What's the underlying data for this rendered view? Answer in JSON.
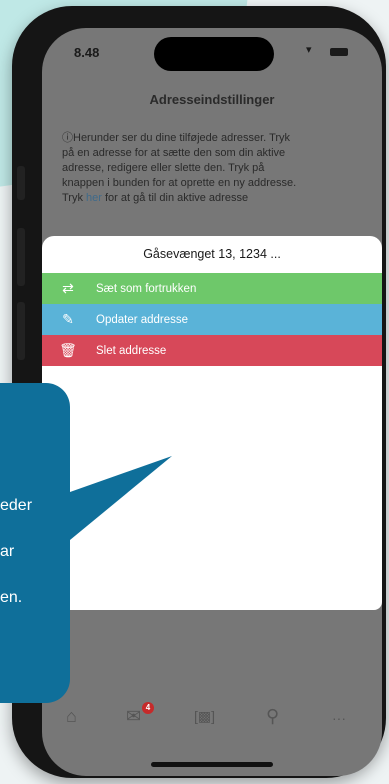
{
  "status": {
    "time": "8.48"
  },
  "nav": {
    "title": "Adresseindstillinger"
  },
  "info": {
    "line1": "ⓘHerunder ser du dine tilføjede adresser. Tryk",
    "line2": "på en adresse for at sætte den som din aktive",
    "line3": "adresse, redigere eller slette den. Tryk på",
    "line4": "knappen i bunden for at oprette en ny addresse.",
    "line5_pre": "Tryk ",
    "line5_link": "her",
    "line5_post": " for at gå til din aktive adresse"
  },
  "sheet": {
    "title": "Gåsevænget 13, 1234 ...",
    "actions": [
      {
        "icon": "swap-arrows-icon",
        "label": "Sæt som fortrukken",
        "color": "#6ec86a"
      },
      {
        "icon": "edit-icon",
        "label": "Opdater addresse",
        "color": "#5ab3d8"
      },
      {
        "icon": "trash-icon",
        "label": "Slet addresse",
        "color": "#d74859"
      }
    ]
  },
  "tabbar": {
    "tabs": [
      "home-icon",
      "inbox-icon",
      "scanner-icon",
      "search-icon",
      "more-icon"
    ],
    "badge": "4"
  },
  "bubble": {
    "lines": [
      "eder",
      "ar",
      "en."
    ],
    "color": "#0f6f9a"
  }
}
